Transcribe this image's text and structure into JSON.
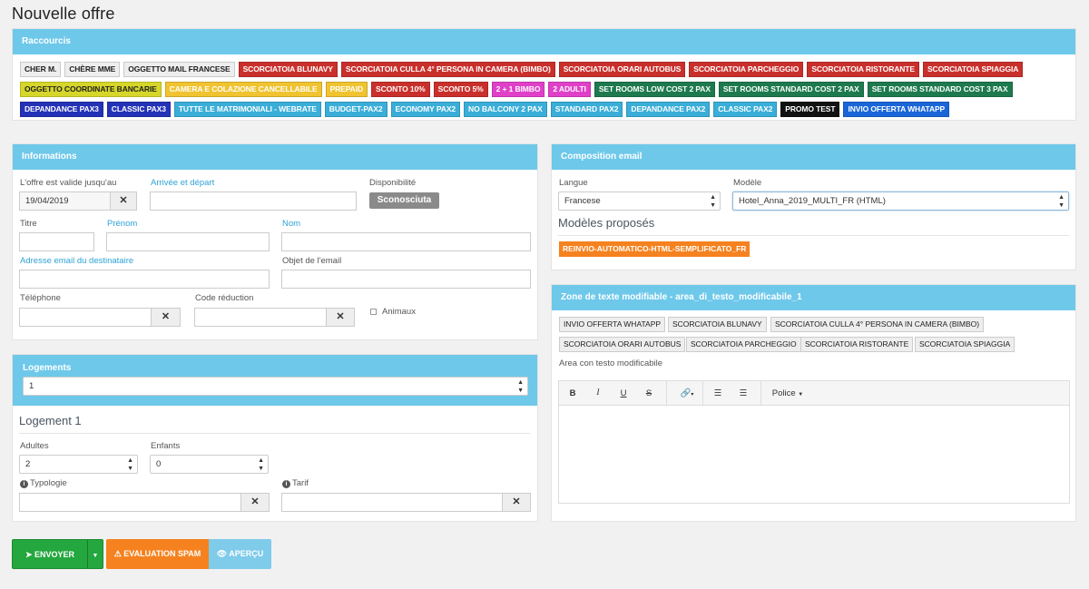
{
  "page": {
    "title": "Nouvelle offre"
  },
  "shortcuts": {
    "title": "Raccourcis",
    "tags": [
      {
        "label": "CHER M.",
        "bg": "#eeeeee",
        "fg": "#222222"
      },
      {
        "label": "CHÈRE MME",
        "bg": "#eeeeee",
        "fg": "#222222"
      },
      {
        "label": "OGGETTO MAIL FRANCESE",
        "bg": "#eeeeee",
        "fg": "#222222"
      },
      {
        "label": "SCORCIATOIA BLUNAVY",
        "bg": "#c9302c",
        "fg": "#ffffff"
      },
      {
        "label": "SCORCIATOIA CULLA 4° PERSONA IN CAMERA (BIMBO)",
        "bg": "#c9302c",
        "fg": "#ffffff"
      },
      {
        "label": "SCORCIATOIA ORARI AUTOBUS",
        "bg": "#c9302c",
        "fg": "#ffffff"
      },
      {
        "label": "SCORCIATOIA PARCHEGGIO",
        "bg": "#c9302c",
        "fg": "#ffffff"
      },
      {
        "label": "SCORCIATOIA RISTORANTE",
        "bg": "#c9302c",
        "fg": "#ffffff"
      },
      {
        "label": "SCORCIATOIA SPIAGGIA",
        "bg": "#c9302c",
        "fg": "#ffffff"
      },
      {
        "label": "OGGETTO COORDINATE BANCARIE",
        "bg": "#d6d62a",
        "fg": "#222222"
      },
      {
        "label": "CAMERA E COLAZIONE CANCELLABILE",
        "bg": "#f0c330",
        "fg": "#ffffff"
      },
      {
        "label": "PREPAID",
        "bg": "#f0c330",
        "fg": "#ffffff"
      },
      {
        "label": "SCONTO 10%",
        "bg": "#c9302c",
        "fg": "#ffffff"
      },
      {
        "label": "SCONTO 5%",
        "bg": "#c9302c",
        "fg": "#ffffff"
      },
      {
        "label": "2 + 1 BIMBO",
        "bg": "#e040c8",
        "fg": "#ffffff"
      },
      {
        "label": "2 ADULTI",
        "bg": "#e040c8",
        "fg": "#ffffff"
      },
      {
        "label": "SET ROOMS LOW COST 2 PAX",
        "bg": "#1e7a4e",
        "fg": "#ffffff"
      },
      {
        "label": "SET ROOMS STANDARD COST 2 PAX",
        "bg": "#1e7a4e",
        "fg": "#ffffff"
      },
      {
        "label": "SET ROOMS STANDARD COST 3 PAX",
        "bg": "#1e7a4e",
        "fg": "#ffffff"
      },
      {
        "label": "DEPANDANCE PAX3",
        "bg": "#2432b8",
        "fg": "#ffffff"
      },
      {
        "label": "CLASSIC PAX3",
        "bg": "#2432b8",
        "fg": "#ffffff"
      },
      {
        "label": "TUTTE LE MATRIMONIALI - WEBRATE",
        "bg": "#3aaed8",
        "fg": "#ffffff"
      },
      {
        "label": "BUDGET-PAX2",
        "bg": "#3aaed8",
        "fg": "#ffffff"
      },
      {
        "label": "ECONOMY PAX2",
        "bg": "#3aaed8",
        "fg": "#ffffff"
      },
      {
        "label": "NO BALCONY 2 PAX",
        "bg": "#3aaed8",
        "fg": "#ffffff"
      },
      {
        "label": "STANDARD PAX2",
        "bg": "#3aaed8",
        "fg": "#ffffff"
      },
      {
        "label": "DEPANDANCE PAX2",
        "bg": "#3aaed8",
        "fg": "#ffffff"
      },
      {
        "label": "CLASSIC PAX2",
        "bg": "#3aaed8",
        "fg": "#ffffff"
      },
      {
        "label": "PROMO TEST",
        "bg": "#111111",
        "fg": "#ffffff"
      },
      {
        "label": "INVIO OFFERTA WHATAPP",
        "bg": "#1a66d8",
        "fg": "#ffffff"
      }
    ]
  },
  "informations": {
    "title": "Informations",
    "valid_until_label": "L'offre est valide jusqu'au",
    "valid_until_value": "19/04/2019",
    "arrival_label": "Arrivée et départ",
    "availability_label": "Disponibilité",
    "availability_value": "Sconosciuta",
    "title_label": "Titre",
    "firstname_label": "Prénom",
    "lastname_label": "Nom",
    "email_label": "Adresse email du destinataire",
    "subject_label": "Objet de l'email",
    "phone_label": "Téléphone",
    "discount_label": "Code réduction",
    "pets_label": "Animaux"
  },
  "logements": {
    "title": "Logements",
    "count_value": "1",
    "section_title": "Logement 1",
    "adults_label": "Adultes",
    "adults_value": "2",
    "children_label": "Enfants",
    "children_value": "0",
    "typology_label": "Typologie",
    "tarif_label": "Tarif"
  },
  "actions": {
    "send_label": "ENVOYER",
    "spam_label": "EVALUATION SPAM",
    "preview_label": "APERÇU"
  },
  "composition": {
    "title": "Composition email",
    "language_label": "Langue",
    "language_value": "Francese",
    "model_label": "Modèle",
    "model_value": "Hotel_Anna_2019_MULTI_FR (HTML)",
    "suggested_title": "Modèles proposés",
    "suggested_tag": "REINVIO-AUTOMATICO-HTML-SEMPLIFICATO_FR"
  },
  "editable_zone": {
    "title": "Zone de texte modifiable - area_di_testo_modificabile_1",
    "buttons": [
      "INVIO OFFERTA WHATAPP",
      "SCORCIATOIA BLUNAVY",
      "SCORCIATOIA CULLA 4° PERSONA IN CAMERA (BIMBO)",
      "SCORCIATOIA ORARI AUTOBUS",
      "SCORCIATOIA PARCHEGGIO",
      "SCORCIATOIA RISTORANTE",
      "SCORCIATOIA SPIAGGIA"
    ],
    "area_label": "Area con testo modificabile",
    "toolbar": {
      "bold": "B",
      "italic": "I",
      "underline": "U",
      "strike": "S",
      "font_label": "Police"
    }
  },
  "icons": {
    "close": "close-icon",
    "send": "paper-plane-icon",
    "warning": "warning-icon",
    "eye": "eye-icon",
    "info": "info-icon",
    "link": "link-icon",
    "list_ul": "list-ul-icon",
    "list_ol": "list-ol-icon"
  }
}
